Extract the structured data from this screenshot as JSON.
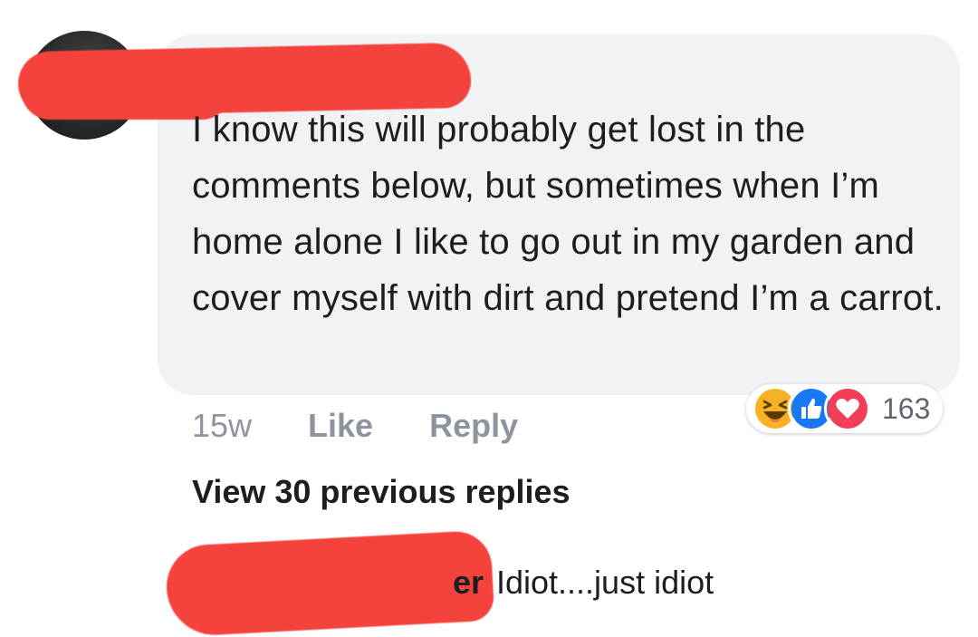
{
  "comment": {
    "text": "I know this will probably get lost in the comments below, but sometimes when I’m home alone I like to go out in my garden and cover myself with dirt and pretend I’m a carrot.",
    "time": "15w",
    "like_label": "Like",
    "reply_label": "Reply",
    "reactions": {
      "icons": [
        "haha-icon",
        "like-icon",
        "love-icon"
      ],
      "count": "163",
      "colors": {
        "haha": "#f7b125",
        "like": "#1877f2",
        "love": "#f33e58"
      }
    }
  },
  "view_previous_replies": "View 30 previous replies",
  "reply": {
    "name_fragment": "er",
    "text": "Idiot....just idiot"
  },
  "colors": {
    "bubble": "#f1f2f6",
    "redaction": "#f4433c",
    "meta_text": "#8d949e",
    "text": "#1c1e21"
  }
}
